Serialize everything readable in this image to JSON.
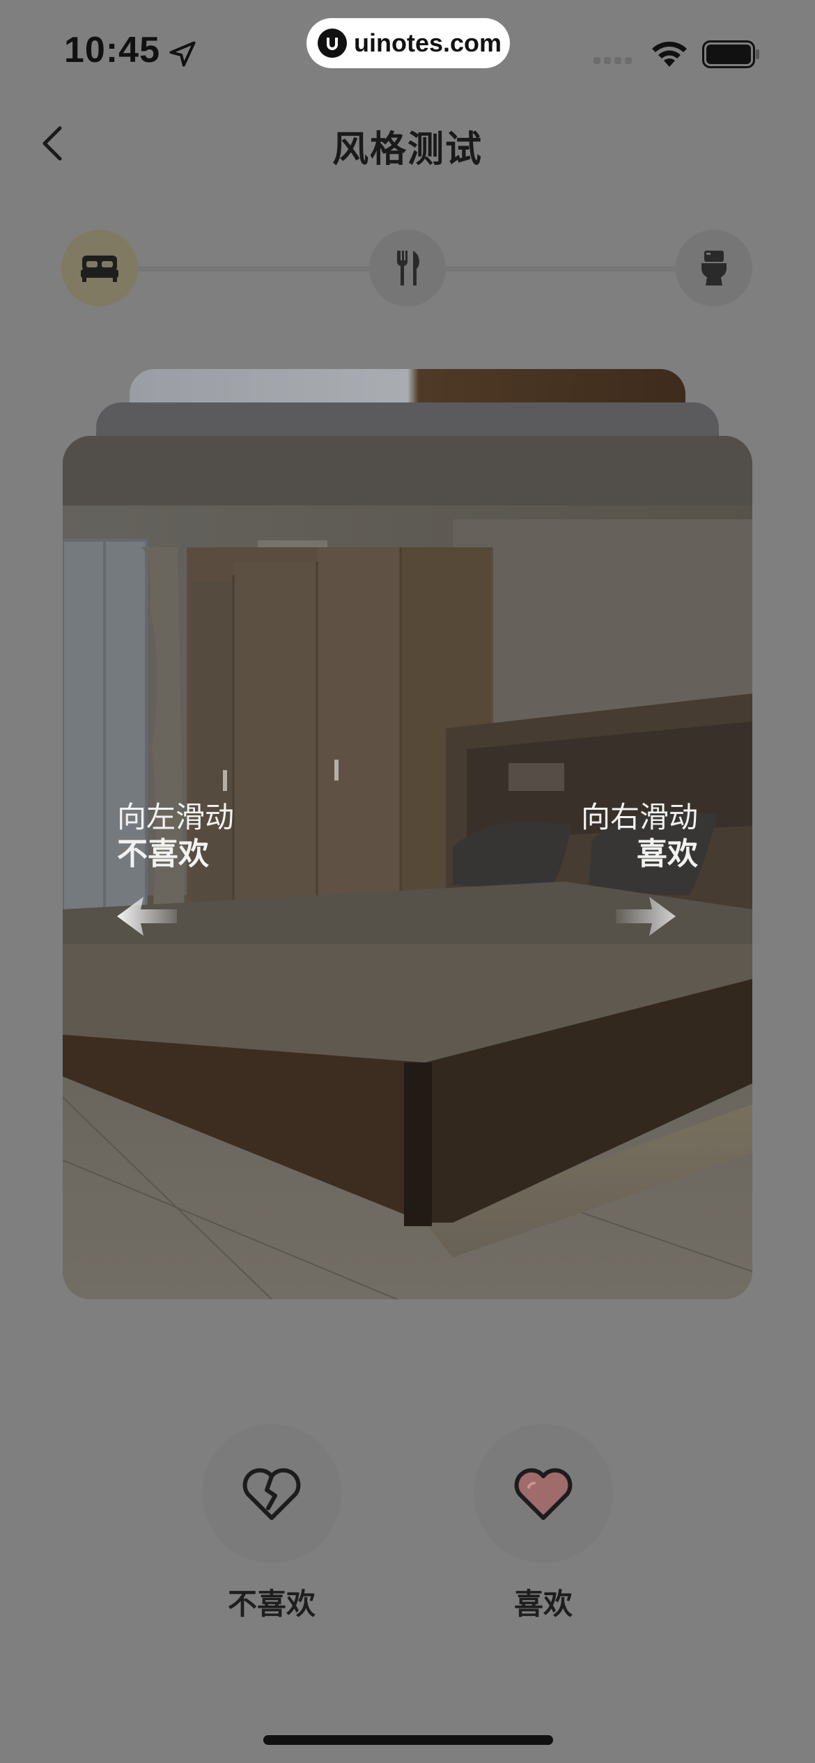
{
  "status_bar": {
    "time": "10:45",
    "watermark": "uinotes.com",
    "icons": [
      "location-arrow-icon",
      "signal-icon",
      "wifi-icon",
      "battery-icon"
    ]
  },
  "header": {
    "title": "风格测试",
    "back_icon": "chevron-left-icon"
  },
  "progress": {
    "steps": [
      {
        "icon": "bed-icon",
        "active": true
      },
      {
        "icon": "fork-knife-icon",
        "active": false
      },
      {
        "icon": "toilet-icon",
        "active": false
      }
    ]
  },
  "card": {
    "image": "bedroom-photo",
    "left_hint": "向左滑动",
    "left_action": "不喜欢",
    "right_hint": "向右滑动",
    "right_action": "喜欢"
  },
  "actions": {
    "dislike_label": "不喜欢",
    "like_label": "喜欢",
    "dislike_icon": "broken-heart-icon",
    "like_icon": "heart-icon"
  },
  "colors": {
    "overlay": "#7f7f7f",
    "active_step": "#807a63",
    "heart": "#a06b6b"
  }
}
